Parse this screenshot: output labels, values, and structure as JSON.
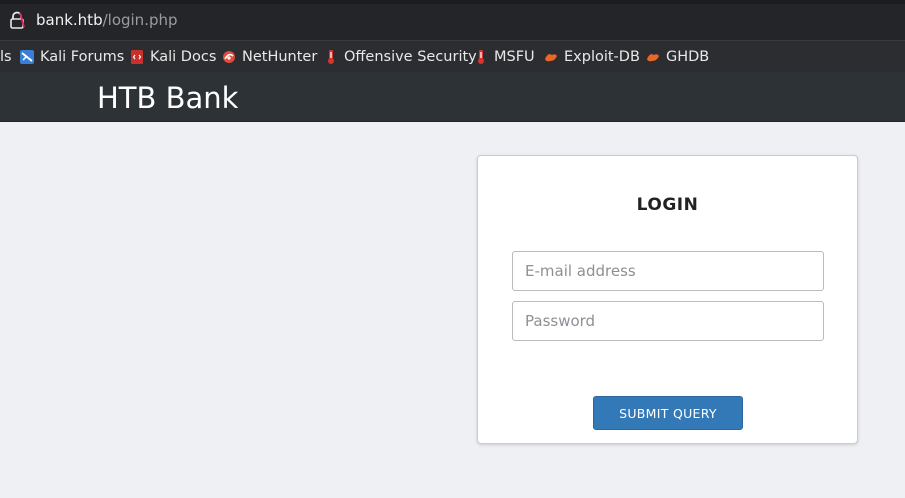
{
  "browser": {
    "url_host": "bank.htb",
    "url_path": "/login.php",
    "bookmarks": [
      {
        "label": "ls",
        "icon": "truncated-bookmark"
      },
      {
        "label": "Kali Forums",
        "icon": "kali-forums-icon"
      },
      {
        "label": "Kali Docs",
        "icon": "kali-docs-icon"
      },
      {
        "label": "NetHunter",
        "icon": "nethunter-icon"
      },
      {
        "label": "Offensive Security",
        "icon": "offsec-icon"
      },
      {
        "label": "MSFU",
        "icon": "msfu-icon"
      },
      {
        "label": "Exploit-DB",
        "icon": "exploit-db-icon"
      },
      {
        "label": "GHDB",
        "icon": "ghdb-icon"
      }
    ]
  },
  "header": {
    "brand": "HTB Bank"
  },
  "login": {
    "title": "LOGIN",
    "email_placeholder": "E-mail address",
    "password_placeholder": "Password",
    "submit_label": "SUBMIT QUERY"
  },
  "colors": {
    "navbar": "#2d3237",
    "page_bg": "#eef0f4",
    "button": "#3479b7"
  }
}
